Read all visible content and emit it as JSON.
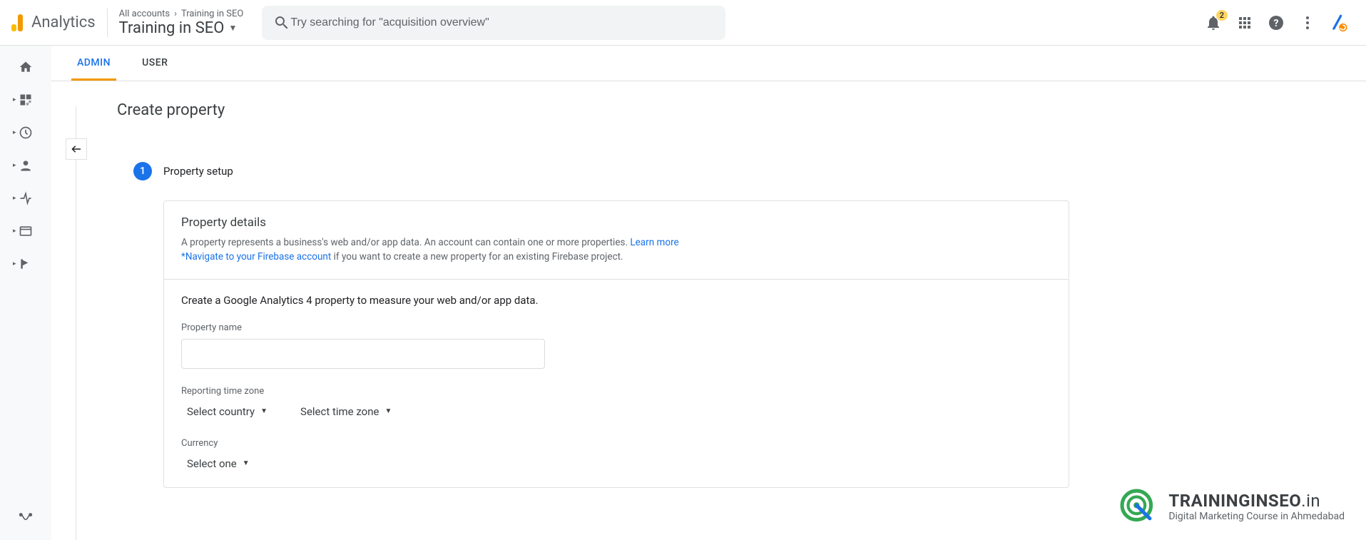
{
  "header": {
    "app_name": "Analytics",
    "breadcrumb_all": "All accounts",
    "breadcrumb_prop": "Training in SEO",
    "account_title": "Training in SEO",
    "search_placeholder": "Try searching for \"acquisition overview\"",
    "badge_count": "2"
  },
  "tabs": {
    "admin": "ADMIN",
    "user": "USER"
  },
  "page": {
    "title": "Create property",
    "step_num": "1",
    "step_title": "Property setup"
  },
  "card": {
    "details_title": "Property details",
    "details_desc": "A property represents a business's web and/or app data. An account can contain one or more properties. ",
    "learn_more": "Learn more",
    "firebase_link": "*Navigate to your Firebase account",
    "firebase_tail": " if you want to create a new property for an existing Firebase project.",
    "ga4_line": "Create a Google Analytics 4 property to measure your web and/or app data.",
    "prop_name_label": "Property name",
    "tz_label": "Reporting time zone",
    "tz_country": "Select country",
    "tz_zone": "Select time zone",
    "currency_label": "Currency",
    "currency_val": "Select one"
  },
  "watermark": {
    "line1a": "TRAININGINSEO",
    "line1b": ".in",
    "line2": "Digital Marketing Course in Ahmedabad"
  }
}
